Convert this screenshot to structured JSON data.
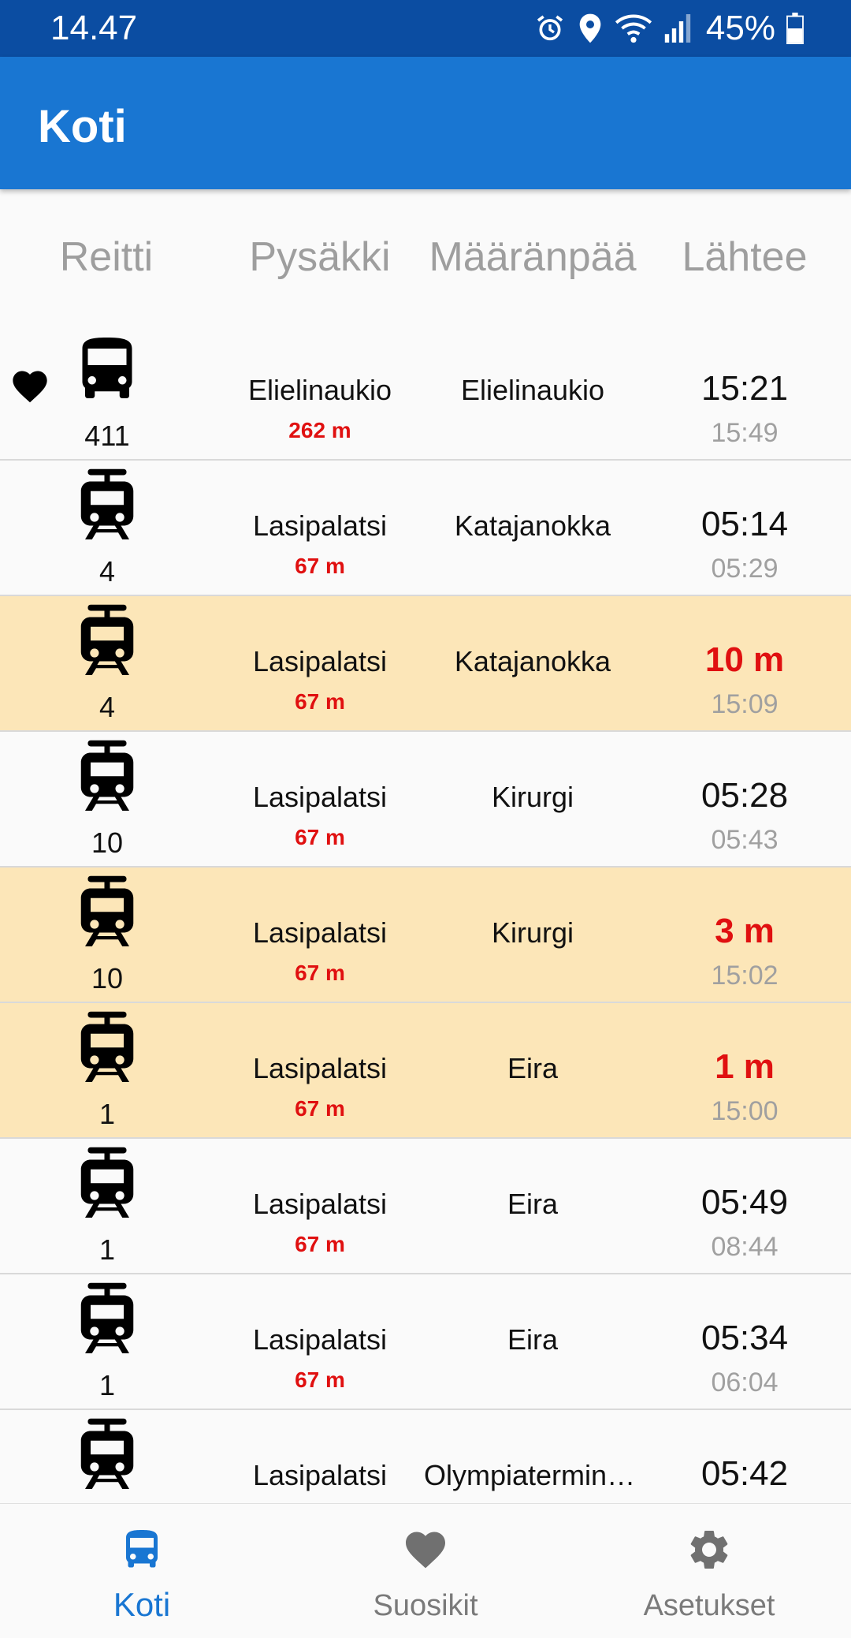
{
  "status_bar": {
    "time": "14.47",
    "battery": "45%",
    "icons": [
      "alarm-icon",
      "location-icon",
      "wifi-icon",
      "signal-icon",
      "battery-icon"
    ]
  },
  "app_bar": {
    "title": "Koti"
  },
  "columns": {
    "route": "Reitti",
    "stop": "Pysäkki",
    "destination": "Määränpää",
    "departs": "Lähtee"
  },
  "rows": [
    {
      "vehicle": "bus",
      "route": "411",
      "stop": "Elielinaukio",
      "distance": "262 m",
      "destination": "Elielinaukio",
      "departure": "15:21",
      "scheduled": "15:49",
      "favorite": true,
      "highlighted": false
    },
    {
      "vehicle": "tram",
      "route": "4",
      "stop": "Lasipalatsi",
      "distance": "67 m",
      "destination": "Katajanokka",
      "departure": "05:14",
      "scheduled": "05:29",
      "favorite": false,
      "highlighted": false
    },
    {
      "vehicle": "tram",
      "route": "4",
      "stop": "Lasipalatsi",
      "distance": "67 m",
      "destination": "Katajanokka",
      "departure": "10 m",
      "scheduled": "15:09",
      "favorite": false,
      "highlighted": true
    },
    {
      "vehicle": "tram",
      "route": "10",
      "stop": "Lasipalatsi",
      "distance": "67 m",
      "destination": "Kirurgi",
      "departure": "05:28",
      "scheduled": "05:43",
      "favorite": false,
      "highlighted": false
    },
    {
      "vehicle": "tram",
      "route": "10",
      "stop": "Lasipalatsi",
      "distance": "67 m",
      "destination": "Kirurgi",
      "departure": "3 m",
      "scheduled": "15:02",
      "favorite": false,
      "highlighted": true
    },
    {
      "vehicle": "tram",
      "route": "1",
      "stop": "Lasipalatsi",
      "distance": "67 m",
      "destination": "Eira",
      "departure": "1 m",
      "scheduled": "15:00",
      "favorite": false,
      "highlighted": true
    },
    {
      "vehicle": "tram",
      "route": "1",
      "stop": "Lasipalatsi",
      "distance": "67 m",
      "destination": "Eira",
      "departure": "05:49",
      "scheduled": "08:44",
      "favorite": false,
      "highlighted": false
    },
    {
      "vehicle": "tram",
      "route": "1",
      "stop": "Lasipalatsi",
      "distance": "67 m",
      "destination": "Eira",
      "departure": "05:34",
      "scheduled": "06:04",
      "favorite": false,
      "highlighted": false
    },
    {
      "vehicle": "tram",
      "route": "",
      "stop": "Lasipalatsi",
      "distance": "",
      "destination": "Olympiaterminaali",
      "departure": "05:42",
      "scheduled": "",
      "favorite": false,
      "highlighted": false
    }
  ],
  "bottom_nav": [
    {
      "label": "Koti",
      "icon": "bus-icon",
      "active": true
    },
    {
      "label": "Suosikit",
      "icon": "heart-icon",
      "active": false
    },
    {
      "label": "Asetukset",
      "icon": "gear-icon",
      "active": false
    }
  ],
  "colors": {
    "status_bar": "#0b4da2",
    "app_bar": "#1976d2",
    "highlight_row": "#fce6b8",
    "alert_red": "#e01010"
  }
}
